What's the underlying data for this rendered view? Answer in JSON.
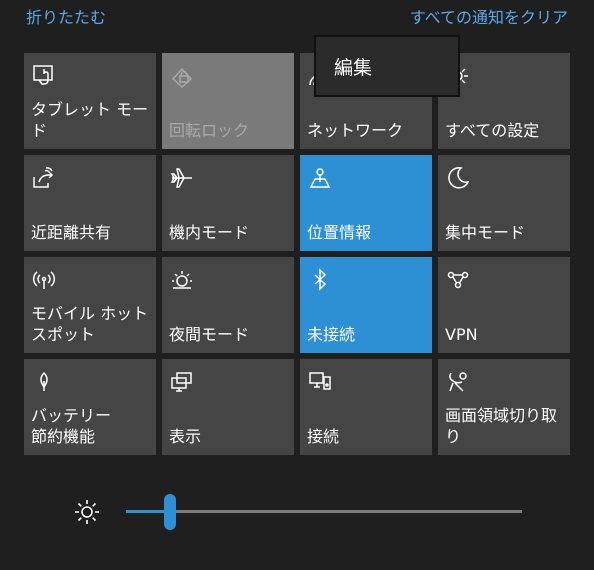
{
  "header": {
    "collapse_label": "折りたたむ",
    "clear_all_label": "すべての通知をクリア"
  },
  "context_menu": {
    "edit_label": "編集"
  },
  "tiles": [
    {
      "label": "タブレット モード",
      "icon": "tablet-mode-icon",
      "state": "off"
    },
    {
      "label": "回転ロック",
      "icon": "rotation-lock-icon",
      "state": "disabled"
    },
    {
      "label": "ネットワーク",
      "icon": "network-icon",
      "state": "off"
    },
    {
      "label": "すべての設定",
      "icon": "gear-icon",
      "state": "off"
    },
    {
      "label": "近距離共有",
      "icon": "nearby-share-icon",
      "state": "off"
    },
    {
      "label": "機内モード",
      "icon": "airplane-icon",
      "state": "off"
    },
    {
      "label": "位置情報",
      "icon": "location-icon",
      "state": "on"
    },
    {
      "label": "集中モード",
      "icon": "moon-icon",
      "state": "off"
    },
    {
      "label": "モバイル ホットスポット",
      "icon": "hotspot-icon",
      "state": "off"
    },
    {
      "label": "夜間モード",
      "icon": "night-light-icon",
      "state": "off"
    },
    {
      "label": "未接続",
      "icon": "bluetooth-icon",
      "state": "on"
    },
    {
      "label": "VPN",
      "icon": "vpn-icon",
      "state": "off"
    },
    {
      "label": "バッテリー\n節約機能",
      "icon": "battery-saver-icon",
      "state": "off"
    },
    {
      "label": "表示",
      "icon": "project-icon",
      "state": "off"
    },
    {
      "label": "接続",
      "icon": "connect-icon",
      "state": "off"
    },
    {
      "label": "画面領域切り取り",
      "icon": "screen-snip-icon",
      "state": "off"
    }
  ],
  "brightness": {
    "icon": "brightness-icon",
    "level": 0.11
  },
  "colors": {
    "accent": "#2d8fd4",
    "tile": "#454545",
    "background": "#1f1f1f"
  }
}
